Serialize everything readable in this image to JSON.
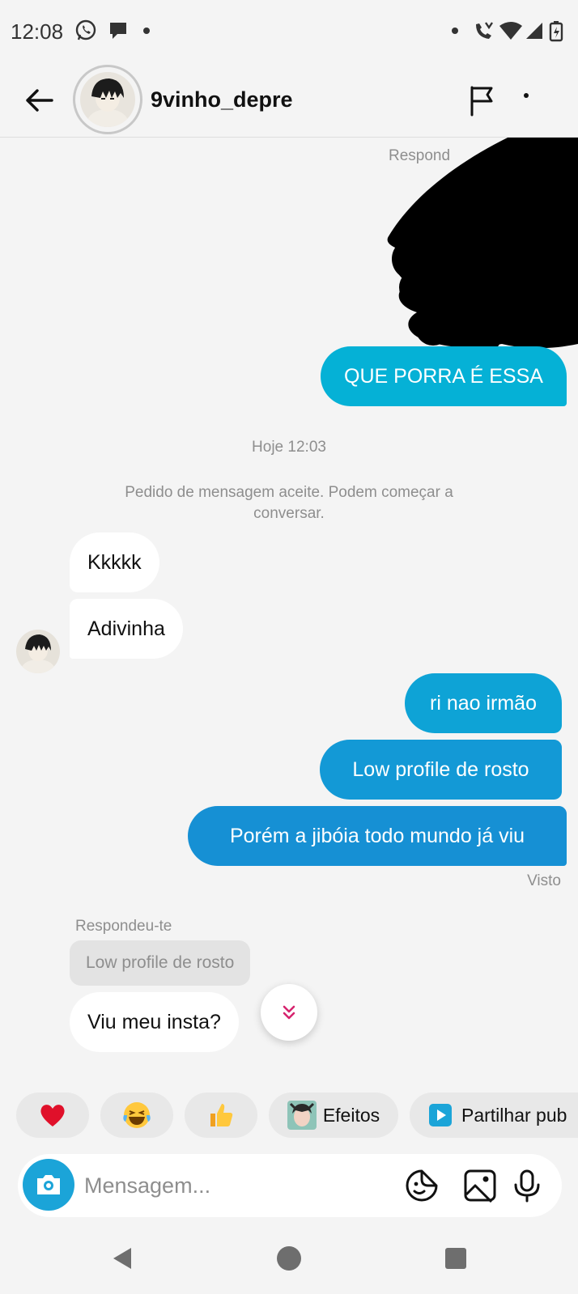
{
  "status_bar": {
    "time": "12:08"
  },
  "header": {
    "username": "9vinho_depre"
  },
  "messages": {
    "truncated_reply_label": "Respond",
    "out_1": "QUE PORRA É ESSA",
    "timestamp": "Hoje 12:03",
    "system_notice": "Pedido de mensagem aceite. Podem começar a conversar.",
    "in_1": "Kkkkk",
    "in_2": "Adivinha",
    "out_2": "ri nao irmão",
    "out_3": "Low profile de rosto",
    "out_4": "Porém a jibóia todo mundo já viu",
    "seen": "Visto",
    "reply_label": "Respondeu-te",
    "reply_quote": "Low profile de rosto",
    "in_3": "Viu meu insta?"
  },
  "reactions": [
    {
      "icon": "heart-emoji",
      "label": "❤️"
    },
    {
      "icon": "laughing-emoji",
      "label": "😂"
    },
    {
      "icon": "thumbs-up-emoji",
      "label": "👍"
    },
    {
      "icon": "effects-avatar",
      "label": "Efeitos"
    },
    {
      "icon": "play-icon",
      "label": "Partilhar pub"
    }
  ],
  "composer": {
    "placeholder": "Mensagem..."
  },
  "colors": {
    "outgoing_light": "#05b1d6",
    "outgoing_dark": "#1690d4",
    "camera": "#1ba4d8",
    "scroll_chevron": "#d6246e"
  }
}
